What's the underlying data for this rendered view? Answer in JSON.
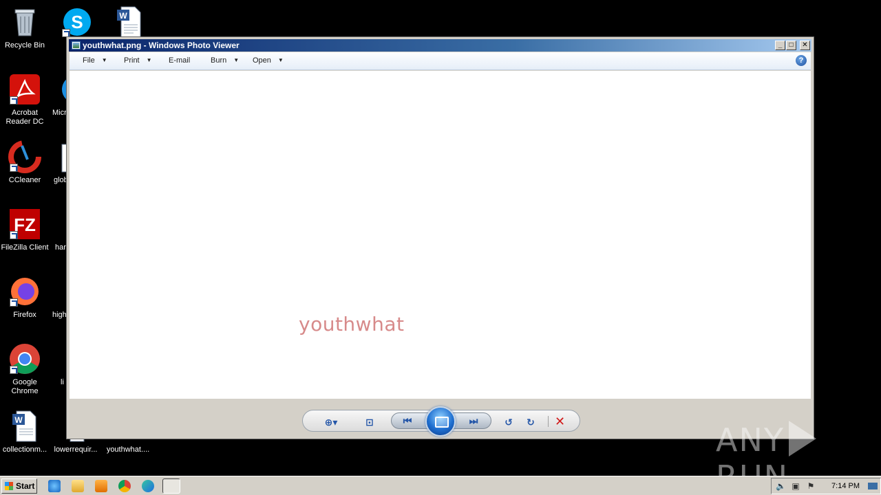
{
  "desktop": {
    "icons": [
      {
        "label": "Recycle Bin",
        "icon": "recycle-bin-icon"
      },
      {
        "label": "Acrobat Reader DC",
        "icon": "acrobat-icon"
      },
      {
        "label": "CCleaner",
        "icon": "ccleaner-icon"
      },
      {
        "label": "FileZilla Client",
        "icon": "filezilla-icon"
      },
      {
        "label": "Firefox",
        "icon": "firefox-icon"
      },
      {
        "label": "Google Chrome",
        "icon": "chrome-icon"
      },
      {
        "label": "collectionm...",
        "icon": "word-doc-icon"
      },
      {
        "label": "Micr",
        "icon": "edge-icon"
      },
      {
        "label": "glob",
        "icon": "word-doc-icon"
      },
      {
        "label": "har",
        "icon": "word-doc-icon"
      },
      {
        "label": "high",
        "icon": "word-doc-icon"
      },
      {
        "label": "li",
        "icon": "word-doc-icon"
      },
      {
        "label": "lowerrequir...",
        "icon": "word-doc-icon"
      },
      {
        "label": "youthwhat....",
        "icon": "image-file-icon"
      }
    ]
  },
  "window": {
    "title": "youthwhat.png - Windows Photo Viewer",
    "menu": [
      {
        "label": "File"
      },
      {
        "label": "Print"
      },
      {
        "label": "E-mail"
      },
      {
        "label": "Burn"
      },
      {
        "label": "Open"
      }
    ],
    "image_text": "youthwhat"
  },
  "taskbar": {
    "start_label": "Start",
    "clock": "7:14 PM"
  },
  "watermark": {
    "left": "ANY",
    "right": "RUN"
  },
  "colors": {
    "titlebar_start": "#0a246a",
    "image_text": "#d78a8a",
    "delete": "#d11a1a"
  }
}
